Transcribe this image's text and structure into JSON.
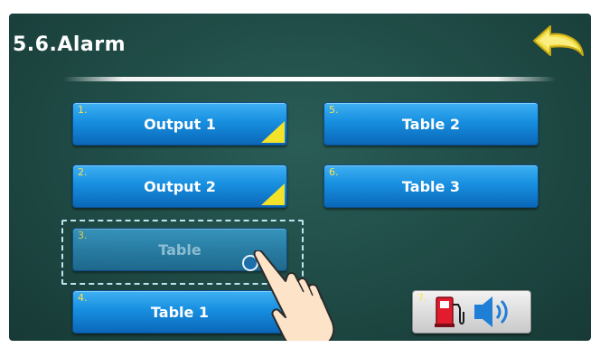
{
  "header": {
    "title": "5.6.Alarm"
  },
  "buttons": {
    "output1": {
      "num": "1.",
      "label": "Output 1"
    },
    "output2": {
      "num": "2.",
      "label": "Output 2"
    },
    "table": {
      "num": "3.",
      "label": "Table"
    },
    "table1": {
      "num": "4.",
      "label": "Table 1"
    },
    "table2": {
      "num": "5.",
      "label": "Table 2"
    },
    "table3": {
      "num": "6.",
      "label": "Table 3"
    },
    "alarm_sound": {
      "num": "7."
    }
  },
  "icons": {
    "back": "back-arrow-icon",
    "fuel_pump": "fuel-pump-icon",
    "speaker": "speaker-icon",
    "corner_flag": "corner-flag-icon",
    "hand": "pointing-hand-icon"
  },
  "colors": {
    "background": "#1e4843",
    "button": "#178fe0",
    "accent": "#f3e22a"
  }
}
